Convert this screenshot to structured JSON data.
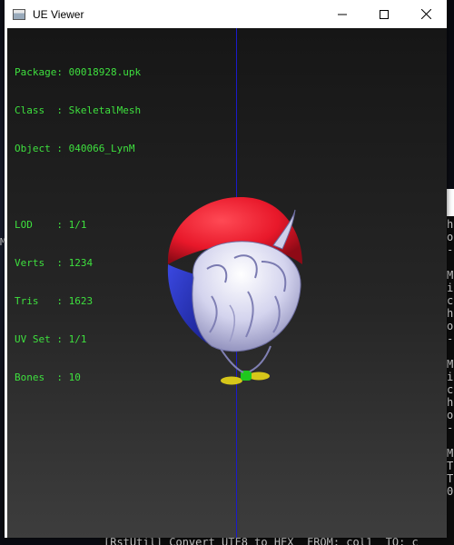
{
  "window": {
    "title": "UE Viewer"
  },
  "info": {
    "package": "Package: 00018928.upk",
    "class": "Class  : SkeletalMesh",
    "object": "Object : 040066_LynM",
    "lod": "LOD    : 1/1",
    "verts": "Verts  : 1234",
    "tris": "Tris   : 1623",
    "uvset": "UV Set : 1/1",
    "bones": "Bones  : 10"
  },
  "desktop": {
    "left_glyph": "M"
  },
  "console": {
    "lines": [
      "h",
      "o",
      "-",
      "",
      "M",
      "i",
      "c",
      "h",
      "o",
      "-",
      "",
      "M",
      "i",
      "c",
      "h",
      "o",
      "-",
      "",
      "M",
      "T",
      "T",
      "0"
    ],
    "bottom_text": "[RstUtil] Convert UTF8 to HEX  FROM: col1  TO: c"
  },
  "colors": {
    "overlay_text": "#3ee03e",
    "axis": "#1a1acb",
    "cap_red": "#e8182a",
    "cap_blue": "#2a36c8",
    "hair": "#dcdcf2",
    "tie_green": "#1ec81e",
    "tie_yellow": "#d6c61a"
  },
  "icons": {
    "app": "app-window-icon",
    "minimize": "minimize-icon",
    "maximize": "maximize-icon",
    "close": "close-icon"
  }
}
